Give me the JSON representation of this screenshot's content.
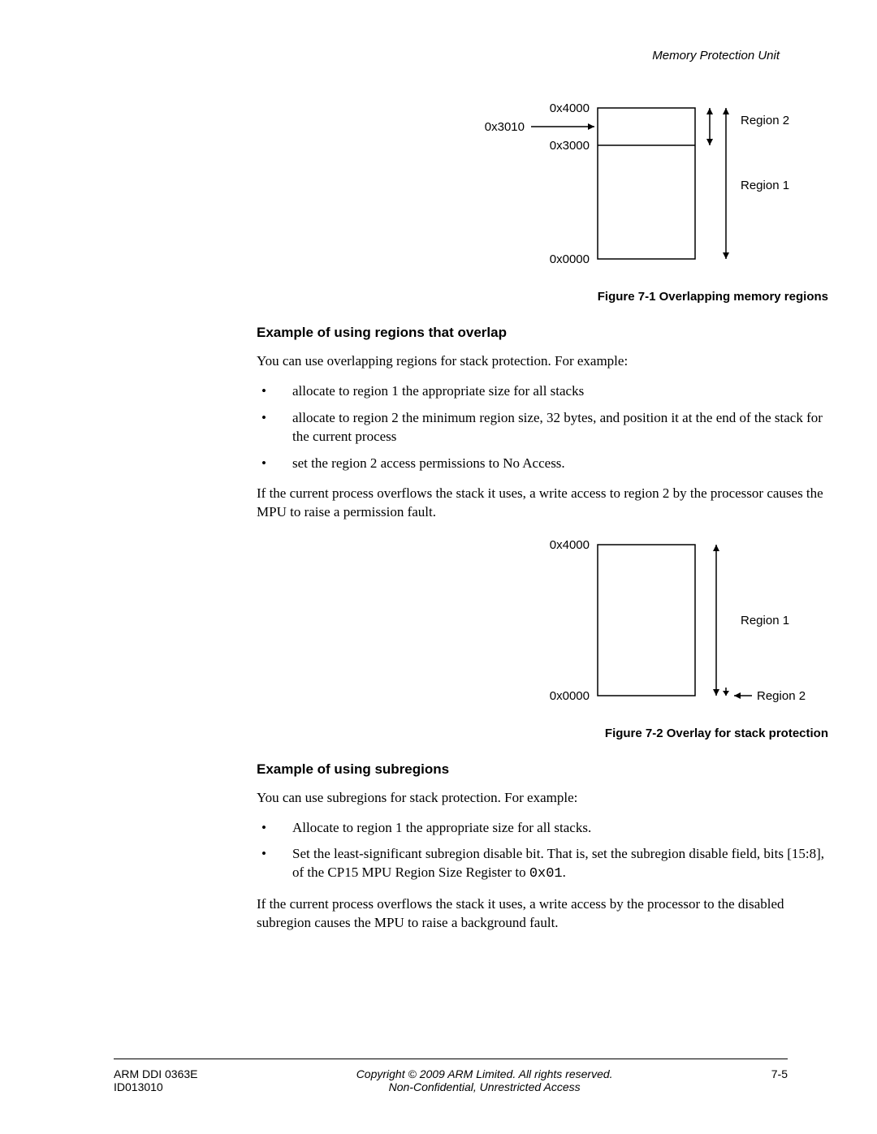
{
  "header": {
    "section": "Memory Protection Unit"
  },
  "chart_data": [
    {
      "type": "diagram",
      "title": "Figure 7-1 Overlapping memory regions",
      "addresses": [
        "0x0000",
        "0x3000",
        "0x3010",
        "0x4000"
      ],
      "regions": [
        {
          "name": "Region 1",
          "start": "0x0000",
          "end": "0x4000"
        },
        {
          "name": "Region 2",
          "start": "0x3000",
          "end": "0x4000"
        }
      ],
      "pointer": {
        "label": "0x3010",
        "between": [
          "0x3000",
          "0x4000"
        ]
      }
    },
    {
      "type": "diagram",
      "title": "Figure 7-2 Overlay for stack protection",
      "addresses": [
        "0x0000",
        "0x4000"
      ],
      "regions": [
        {
          "name": "Region 1",
          "start": "0x0000",
          "end": "0x4000"
        },
        {
          "name": "Region 2",
          "at": "0x0000"
        }
      ]
    }
  ],
  "fig1": {
    "caption": "Figure 7-1 Overlapping memory regions",
    "addr_top": "0x4000",
    "addr_mid": "0x3000",
    "addr_ptr": "0x3010",
    "addr_bot": "0x0000",
    "region1": "Region 1",
    "region2": "Region 2"
  },
  "section1": {
    "heading": "Example of using regions that overlap",
    "intro": "You can use overlapping regions for stack protection. For example:",
    "bullets": [
      "allocate to region 1 the appropriate size for all stacks",
      "allocate to region 2 the minimum region size, 32 bytes, and position it at the end of the stack for the current process",
      "set the region 2 access permissions to No Access."
    ],
    "outro": "If the current process overflows the stack it uses, a write access to region 2 by the processor causes the MPU to raise a permission fault."
  },
  "fig2": {
    "caption": "Figure 7-2 Overlay for stack protection",
    "addr_top": "0x4000",
    "addr_bot": "0x0000",
    "region1": "Region 1",
    "region2": "Region 2"
  },
  "section2": {
    "heading": "Example of using subregions",
    "intro": "You can use subregions for stack protection. For example:",
    "bullets": [
      "Allocate to region 1 the appropriate size for all stacks.",
      "Set the least-significant subregion disable bit. That is, set the subregion disable field, bits [15:8], of the CP15 MPU Region Size Register to "
    ],
    "code": "0x01",
    "outro": "If the current process overflows the stack it uses, a write access by the processor to the disabled subregion causes the MPU to raise a background fault."
  },
  "footer": {
    "left1": "ARM DDI 0363E",
    "left2": "ID013010",
    "center1": "Copyright © 2009 ARM Limited. All rights reserved.",
    "center2": "Non-Confidential, Unrestricted Access",
    "right": "7-5"
  }
}
